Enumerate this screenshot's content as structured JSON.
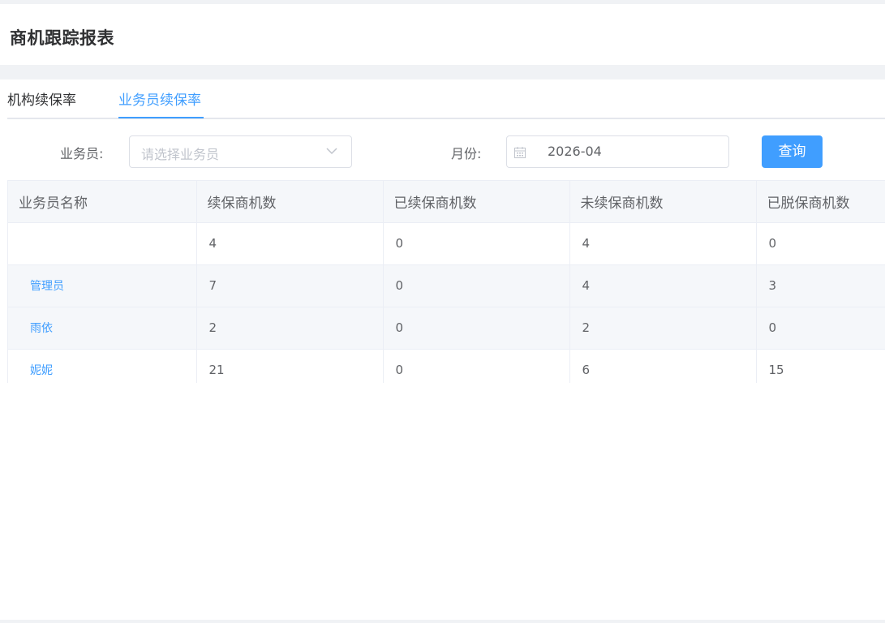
{
  "page": {
    "title": "商机跟踪报表"
  },
  "tabs": [
    {
      "label": "机构续保率",
      "active": false
    },
    {
      "label": "业务员续保率",
      "active": true
    }
  ],
  "filters": {
    "salesperson_label": "业务员:",
    "salesperson_placeholder": "请选择业务员",
    "month_label": "月份:",
    "month_value": "2026-04",
    "query_button": "查询"
  },
  "table": {
    "columns": [
      "业务员名称",
      "续保商机数",
      "已续保商机数",
      "未续保商机数",
      "已脱保商机数"
    ],
    "rows": [
      {
        "name": "",
        "renewal_total": "4",
        "renewed": "0",
        "not_renewed": "4",
        "lapsed": "0"
      },
      {
        "name": "管理员",
        "renewal_total": "7",
        "renewed": "0",
        "not_renewed": "4",
        "lapsed": "3"
      },
      {
        "name": "雨依",
        "renewal_total": "2",
        "renewed": "0",
        "not_renewed": "2",
        "lapsed": "0"
      },
      {
        "name": "妮妮",
        "renewal_total": "21",
        "renewed": "0",
        "not_renewed": "6",
        "lapsed": "15"
      }
    ]
  },
  "colors": {
    "accent": "#409eff",
    "header_bg": "#f5f7fa",
    "border": "#ebeef5"
  },
  "icons": {
    "select_arrow": "chevron-down-icon",
    "date_picker": "calendar-icon"
  }
}
